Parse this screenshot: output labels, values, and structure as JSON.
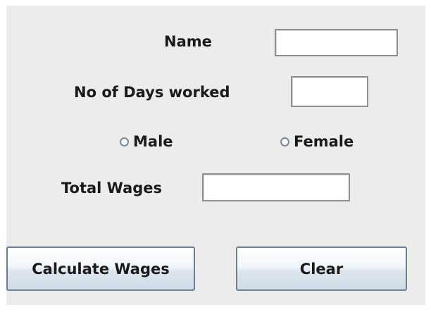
{
  "form": {
    "name_label": "Name",
    "days_label": "No of Days worked",
    "male_label": "Male",
    "female_label": "Female",
    "total_wages_label": "Total Wages",
    "name_value": "",
    "days_value": "",
    "total_wages_value": ""
  },
  "buttons": {
    "calculate_label": "Calculate Wages",
    "clear_label": "Clear"
  },
  "colors": {
    "panel_background": "#ececec",
    "page_background": "#ffffff",
    "button_border": "#6f7e8e",
    "field_border": "#8f8f8f"
  }
}
